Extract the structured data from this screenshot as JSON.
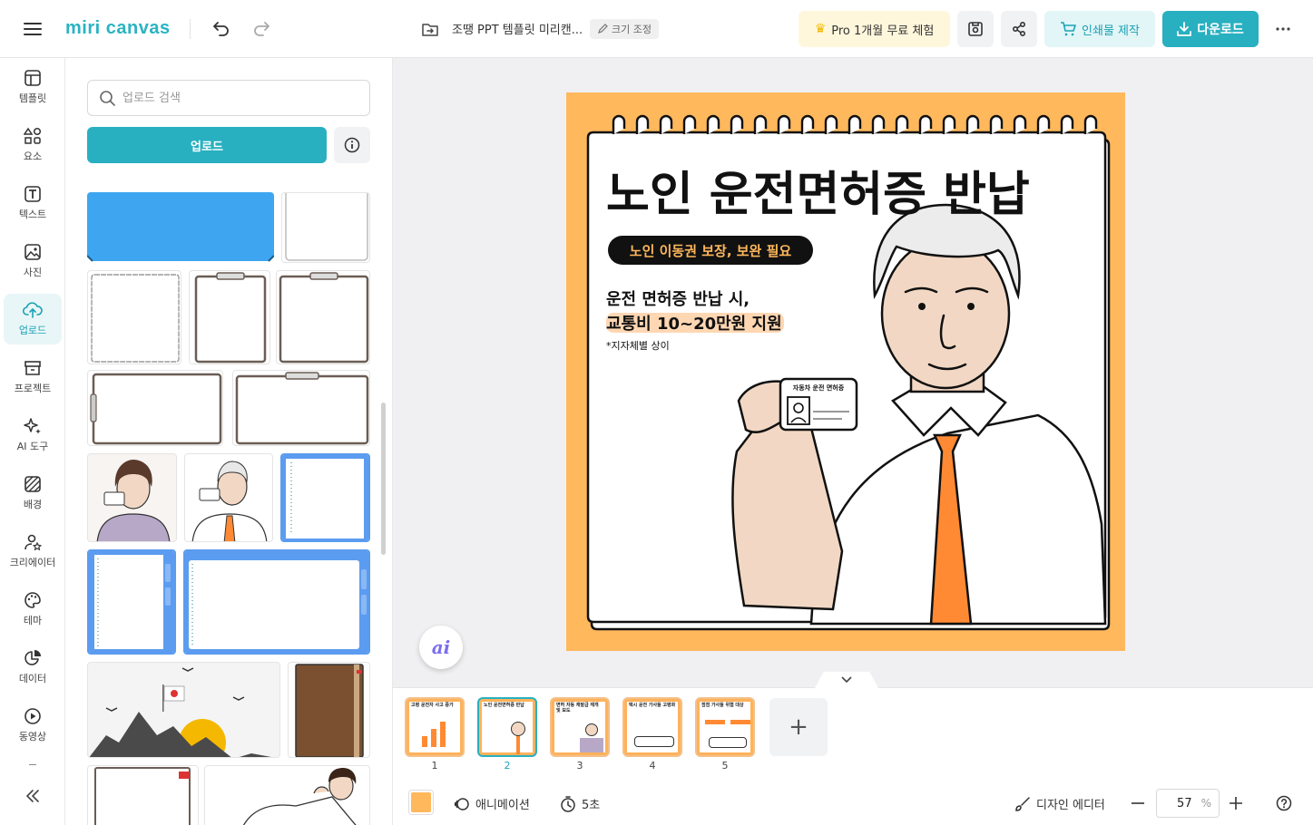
{
  "header": {
    "logo": "miri canvas",
    "doc_title": "조땡 PPT 템플릿 미리캔...",
    "resize_label": "크기 조정",
    "pro_label": "Pro 1개월 무료 체험",
    "print_label": "인쇄물 제작",
    "download_label": "다운로드"
  },
  "nav": {
    "items": [
      {
        "label": "템플릿",
        "icon": "template-icon"
      },
      {
        "label": "요소",
        "icon": "elements-icon"
      },
      {
        "label": "텍스트",
        "icon": "text-icon"
      },
      {
        "label": "사진",
        "icon": "photo-icon"
      },
      {
        "label": "업로드",
        "icon": "upload-cloud-icon"
      },
      {
        "label": "프로젝트",
        "icon": "project-icon"
      },
      {
        "label": "AI 도구",
        "icon": "ai-sparkle-icon"
      },
      {
        "label": "배경",
        "icon": "background-icon"
      },
      {
        "label": "크리에이터",
        "icon": "creator-icon"
      },
      {
        "label": "테마",
        "icon": "palette-icon"
      },
      {
        "label": "데이터",
        "icon": "chart-icon"
      },
      {
        "label": "동영상",
        "icon": "play-icon"
      }
    ]
  },
  "panel": {
    "search_placeholder": "업로드 검색",
    "upload_label": "업로드"
  },
  "slide": {
    "title": "노인 운전면허증 반납",
    "pill": "노인 이동권 보장, 보완 필요",
    "body_line1": "운전 면허증 반납 시,",
    "body_line2": "교통비 10~20만원 지원",
    "note": "*지자체별 상이",
    "card_label": "자동차 운전 면허증",
    "bg_color": "#ffb85c",
    "accent_color": "#ff8a33"
  },
  "slides": [
    {
      "num": "1",
      "caption": "고령 운전자 사고 증가"
    },
    {
      "num": "2",
      "caption": "노인 운전면허증 반납"
    },
    {
      "num": "3",
      "caption": "면허 자동 재발급 재개 및 보도"
    },
    {
      "num": "4",
      "caption": "택시 운전 가사들 고령화"
    },
    {
      "num": "5",
      "caption": "점점 가사들 위협 대상"
    }
  ],
  "bottom": {
    "page_color": "#ffb85c",
    "animation_label": "애니메이션",
    "duration_label": "5초",
    "design_editor_label": "디자인 에디터",
    "zoom_value": "57",
    "zoom_unit": "%"
  }
}
